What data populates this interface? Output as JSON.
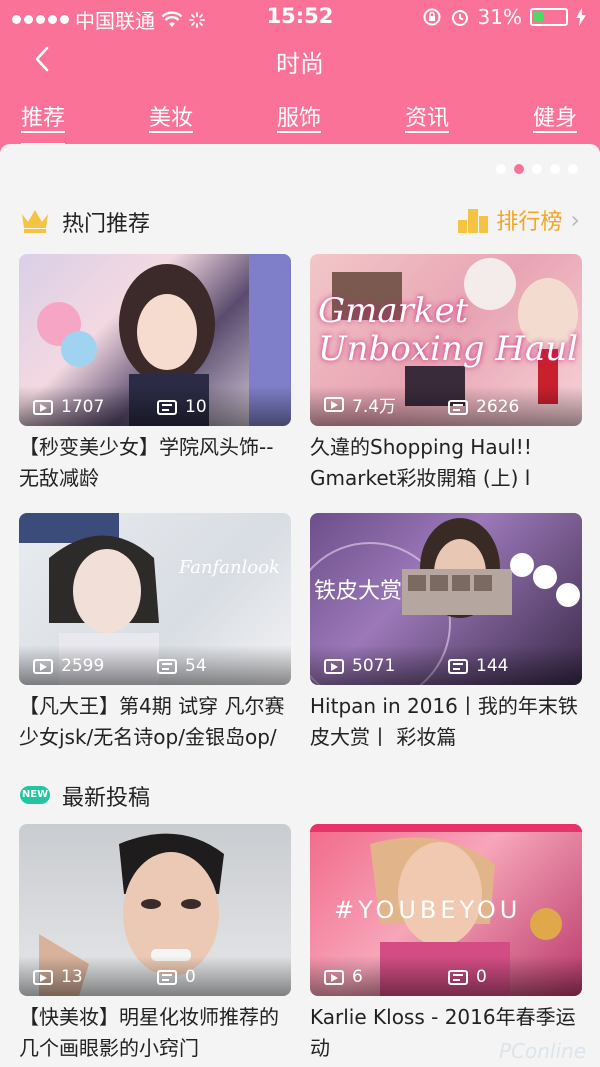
{
  "status_bar": {
    "carrier": "中国联通",
    "time": "15:52",
    "battery": "31%",
    "battery_level": 0.31
  },
  "nav": {
    "title": "时尚"
  },
  "tabs": [
    {
      "label": "推荐",
      "active": true
    },
    {
      "label": "美妆"
    },
    {
      "label": "服饰"
    },
    {
      "label": "资讯"
    },
    {
      "label": "健身"
    }
  ],
  "banner_pages": {
    "count": 5,
    "current": 2
  },
  "hot": {
    "title": "热门推荐",
    "rank_label": "排行榜",
    "cards": [
      {
        "title": "【秒变美少女】学院风头饰--无敌减龄",
        "plays": "1707",
        "danmaku": "10"
      },
      {
        "title": "久違的Shopping Haul!! Gmarket彩妝開箱 (上) l",
        "plays": "7.4万",
        "danmaku": "2626",
        "overlay": "Gmarket Unboxing Haul"
      },
      {
        "title": "【凡大王】第4期 试穿 凡尔赛少女jsk/无名诗op/金银岛op/",
        "plays": "2599",
        "danmaku": "54",
        "overlay": "Fanfanlook"
      },
      {
        "title": "Hitpan in 2016丨我的年末铁皮大赏丨 彩妆篇",
        "plays": "5071",
        "danmaku": "144",
        "overlay": "铁皮大赏"
      }
    ]
  },
  "latest": {
    "badge": "NEW",
    "title": "最新投稿",
    "cards": [
      {
        "title": "【快美妆】明星化妆师推荐的几个画眼影的小窍门",
        "plays": "13",
        "danmaku": "0"
      },
      {
        "title": "Karlie Kloss - 2016年春季运动",
        "plays": "6",
        "danmaku": "0",
        "overlay": "#YOUBEYOU"
      }
    ]
  },
  "watermark": "PConline",
  "colors": {
    "brand_pink": "#fb7299",
    "rank_orange": "#f5a623",
    "new_green": "#22c5a0"
  }
}
